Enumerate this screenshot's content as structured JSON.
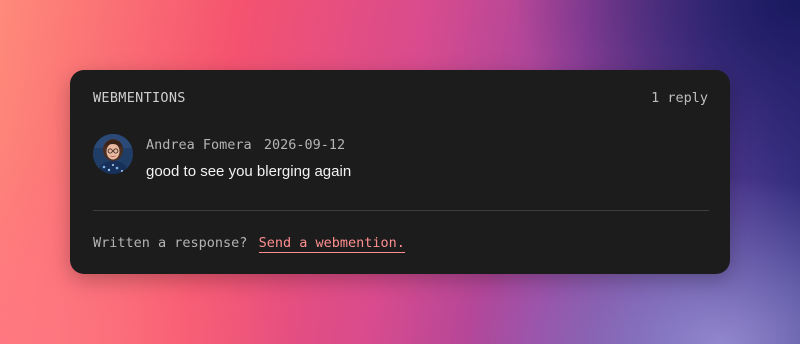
{
  "webmentions": {
    "heading": "WEBMENTIONS",
    "count_label": "1 reply",
    "replies": [
      {
        "author": "Andrea Fomera",
        "date": "2026-09-12",
        "text": "good to see you blerging again"
      }
    ],
    "footer": {
      "prompt": "Written a response?",
      "link_label": "Send a webmention."
    }
  },
  "colors": {
    "card_background": "#1c1c1d",
    "link": "#ff8f8f",
    "divider": "#3d3d3f"
  }
}
